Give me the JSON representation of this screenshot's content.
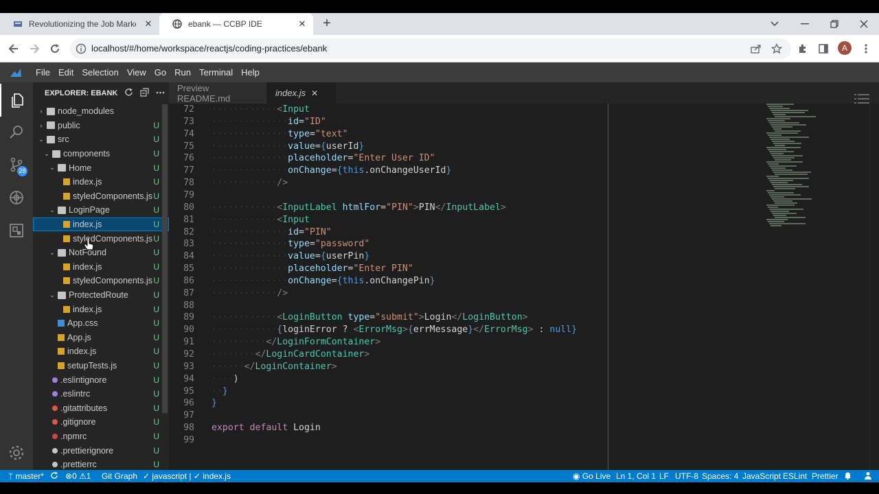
{
  "browser": {
    "tabs": [
      {
        "title": "Revolutionizing the Job Market",
        "close": "✕"
      },
      {
        "title": "ebank — CCBP IDE",
        "close": "✕"
      }
    ],
    "new_tab": "+",
    "url": "localhost/#/home/workspace/reactjs/coding-practices/ebank",
    "avatar_letter": "A"
  },
  "menu": [
    "File",
    "Edit",
    "Selection",
    "View",
    "Go",
    "Run",
    "Terminal",
    "Help"
  ],
  "activity": {
    "scm_badge": "28"
  },
  "explorer": {
    "title": "EXPLORER: EBANK",
    "tree": [
      {
        "name": "node_modules",
        "kind": "folder",
        "open": false,
        "depth": 0,
        "git": ""
      },
      {
        "name": "public",
        "kind": "folder",
        "open": false,
        "depth": 0,
        "git": "U"
      },
      {
        "name": "src",
        "kind": "folder",
        "open": true,
        "depth": 0,
        "git": "U"
      },
      {
        "name": "components",
        "kind": "folder",
        "open": true,
        "depth": 1,
        "git": "U"
      },
      {
        "name": "Home",
        "kind": "folder",
        "open": true,
        "depth": 2,
        "git": "U"
      },
      {
        "name": "index.js",
        "kind": "js",
        "depth": 3,
        "git": "U"
      },
      {
        "name": "styledComponents.js",
        "kind": "js",
        "depth": 3,
        "git": "U"
      },
      {
        "name": "LoginPage",
        "kind": "folder",
        "open": true,
        "depth": 2,
        "git": "U"
      },
      {
        "name": "index.js",
        "kind": "js",
        "depth": 3,
        "git": "U",
        "selected": true
      },
      {
        "name": "styledComponents.js",
        "kind": "js",
        "depth": 3,
        "git": "U"
      },
      {
        "name": "NotFound",
        "kind": "folder",
        "open": true,
        "depth": 2,
        "git": "U"
      },
      {
        "name": "index.js",
        "kind": "js",
        "depth": 3,
        "git": "U"
      },
      {
        "name": "styledComponents.js",
        "kind": "js",
        "depth": 3,
        "git": "U"
      },
      {
        "name": "ProtectedRoute",
        "kind": "folder",
        "open": true,
        "depth": 2,
        "git": "U"
      },
      {
        "name": "index.js",
        "kind": "js",
        "depth": 3,
        "git": "U"
      },
      {
        "name": "App.css",
        "kind": "css",
        "depth": 2,
        "git": "U"
      },
      {
        "name": "App.js",
        "kind": "js",
        "depth": 2,
        "git": "U"
      },
      {
        "name": "index.js",
        "kind": "js",
        "depth": 2,
        "git": "U"
      },
      {
        "name": "setupTests.js",
        "kind": "js",
        "depth": 2,
        "git": "U"
      },
      {
        "name": ".eslintignore",
        "kind": "eslint",
        "depth": 1,
        "git": "U"
      },
      {
        "name": ".eslintrc",
        "kind": "eslint",
        "depth": 1,
        "git": "U"
      },
      {
        "name": ".gitattributes",
        "kind": "git",
        "depth": 1,
        "git": "U"
      },
      {
        "name": ".gitignore",
        "kind": "git",
        "depth": 1,
        "git": "U"
      },
      {
        "name": ".npmrc",
        "kind": "npm",
        "depth": 1,
        "git": "U"
      },
      {
        "name": ".prettierignore",
        "kind": "gear",
        "depth": 1,
        "git": "U"
      },
      {
        "name": ".prettierrc",
        "kind": "gear",
        "depth": 1,
        "git": "U"
      }
    ]
  },
  "editor": {
    "tabs": [
      {
        "label": "Preview README.md",
        "active": false
      },
      {
        "label": "index.js",
        "active": true,
        "close": "✕"
      }
    ],
    "lines": [
      {
        "n": "72",
        "t": "            <Input"
      },
      {
        "n": "73",
        "t": "              id=\"ID\""
      },
      {
        "n": "74",
        "t": "              type=\"text\""
      },
      {
        "n": "75",
        "t": "              value={userId}"
      },
      {
        "n": "76",
        "t": "              placeholder=\"Enter User ID\""
      },
      {
        "n": "77",
        "t": "              onChange={this.onChangeUserId}"
      },
      {
        "n": "78",
        "t": "            />"
      },
      {
        "n": "79",
        "t": ""
      },
      {
        "n": "80",
        "t": "            <InputLabel htmlFor=\"PIN\">PIN</InputLabel>"
      },
      {
        "n": "81",
        "t": "            <Input"
      },
      {
        "n": "82",
        "t": "              id=\"PIN\""
      },
      {
        "n": "83",
        "t": "              type=\"password\""
      },
      {
        "n": "84",
        "t": "              value={userPin}"
      },
      {
        "n": "85",
        "t": "              placeholder=\"Enter PIN\""
      },
      {
        "n": "86",
        "t": "              onChange={this.onChangePin}"
      },
      {
        "n": "87",
        "t": "            />"
      },
      {
        "n": "88",
        "t": ""
      },
      {
        "n": "89",
        "t": "            <LoginButton type=\"submit\">Login</LoginButton>"
      },
      {
        "n": "90",
        "t": "            {loginError ? <ErrorMsg>{errMessage}</ErrorMsg> : null}"
      },
      {
        "n": "91",
        "t": "          </LoginFormContainer>"
      },
      {
        "n": "92",
        "t": "        </LoginCardContainer>"
      },
      {
        "n": "93",
        "t": "      </LoginContainer>"
      },
      {
        "n": "94",
        "t": "    )"
      },
      {
        "n": "95",
        "t": "  }"
      },
      {
        "n": "96",
        "t": "}"
      },
      {
        "n": "97",
        "t": ""
      },
      {
        "n": "98",
        "t": "export default Login"
      },
      {
        "n": "99",
        "t": ""
      }
    ]
  },
  "status": {
    "branch": "master*",
    "problems": "0",
    "warnings": "1",
    "git_graph": "Git Graph",
    "lang_check": "javascript",
    "file_check": "index.js",
    "go_live": "Go Live",
    "position": "Ln 1, Col 1",
    "eol": "LF",
    "encoding": "UTF-8",
    "spaces": "Spaces: 4",
    "language": "JavaScript",
    "eslint": "ESLint",
    "prettier": "Prettier"
  },
  "colors": {
    "statusbar": "#007acc",
    "selection": "#094771",
    "git_untracked": "#73c991"
  }
}
